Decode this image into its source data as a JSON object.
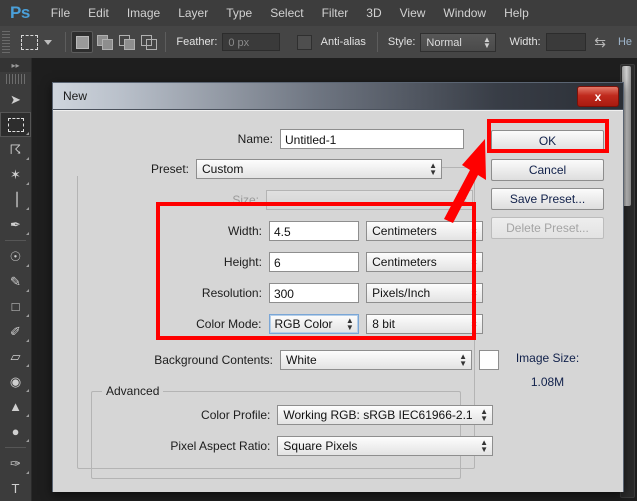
{
  "app": {
    "logo": "Ps",
    "menus": [
      "File",
      "Edit",
      "Image",
      "Layer",
      "Type",
      "Select",
      "Filter",
      "3D",
      "View",
      "Window",
      "Help"
    ]
  },
  "options_bar": {
    "tool_icon": "rectangular-marquee",
    "selection_modes": [
      "new-selection",
      "add-to-selection",
      "subtract-from-selection",
      "intersect-with-selection"
    ],
    "feather_label": "Feather:",
    "feather_value": "0 px",
    "antialias_label": "Anti-alias",
    "style_label": "Style:",
    "style_value": "Normal",
    "width_label": "Width:",
    "width_value": "",
    "swap_icon": "swap-arrows",
    "height_label": "He"
  },
  "toolbar": {
    "collapse_icon": "double-chevron-right",
    "tools": [
      {
        "name": "move-tool",
        "glyph": "➤"
      },
      {
        "name": "rectangular-marquee-tool",
        "glyph": ""
      },
      {
        "name": "lasso-tool",
        "glyph": "⌒"
      },
      {
        "name": "magic-wand-tool",
        "glyph": "✦"
      },
      {
        "name": "crop-tool",
        "glyph": "⌗"
      },
      {
        "name": "eyedropper-tool",
        "glyph": "✒"
      },
      {
        "name": "spot-healing-brush-tool",
        "glyph": "⚕"
      },
      {
        "name": "brush-tool",
        "glyph": "✎"
      },
      {
        "name": "clone-stamp-tool",
        "glyph": "⚑"
      },
      {
        "name": "history-brush-tool",
        "glyph": "✐"
      },
      {
        "name": "eraser-tool",
        "glyph": "▱"
      },
      {
        "name": "paint-bucket-tool",
        "glyph": "⬤"
      },
      {
        "name": "gradient-tool",
        "glyph": "▲"
      },
      {
        "name": "blur-tool",
        "glyph": "●"
      },
      {
        "name": "pen-tool",
        "glyph": "✑"
      },
      {
        "name": "type-tool",
        "glyph": "T"
      }
    ]
  },
  "dialog": {
    "title": "New",
    "close_icon": "close-x",
    "name_label": "Name:",
    "name_value": "Untitled-1",
    "preset_label": "Preset:",
    "preset_value": "Custom",
    "size_label": "Size:",
    "size_value": "",
    "width_label": "Width:",
    "width_value": "4.5",
    "width_unit": "Centimeters",
    "height_label": "Height:",
    "height_value": "6",
    "height_unit": "Centimeters",
    "resolution_label": "Resolution:",
    "resolution_value": "300",
    "resolution_unit": "Pixels/Inch",
    "color_mode_label": "Color Mode:",
    "color_mode_value": "RGB Color",
    "color_depth_value": "8 bit",
    "background_label": "Background Contents:",
    "background_value": "White",
    "background_swatch": "#ffffff",
    "advanced_legend": "Advanced",
    "color_profile_label": "Color Profile:",
    "color_profile_value": "Working RGB:  sRGB IEC61966-2.1",
    "pixel_aspect_label": "Pixel Aspect Ratio:",
    "pixel_aspect_value": "Square Pixels",
    "buttons": {
      "ok": "OK",
      "cancel": "Cancel",
      "save_preset": "Save Preset...",
      "delete_preset": "Delete Preset..."
    },
    "image_size_label": "Image Size:",
    "image_size_value": "1.08M"
  },
  "annotations": {
    "highlight_color": "#ff0000",
    "ok_highlight": "ok-button-highlight",
    "fields_highlight": "dimension-fields-highlight",
    "arrow": "red-arrow-pointing-to-ok"
  }
}
